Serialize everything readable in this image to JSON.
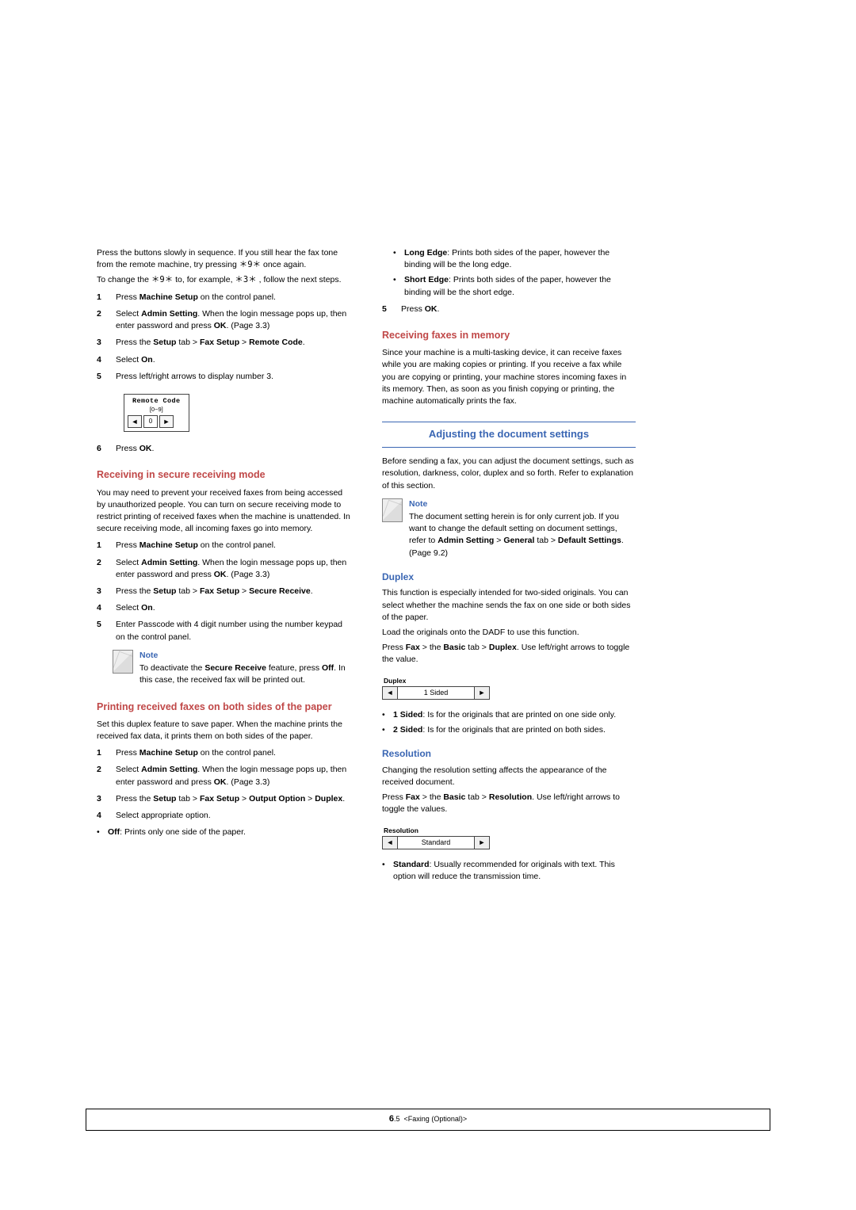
{
  "left": {
    "intro1": "Press the buttons slowly in sequence. If you still hear the fax tone from the remote machine, try pressing ",
    "star9star": "＊9＊",
    "onceagain": " once again.",
    "change_intro": "To change the ",
    "to_eg": " to, for example, ",
    "star3star": "＊3＊",
    "follow": " , follow the next steps.",
    "s1": {
      "num": "1",
      "pre": "Press ",
      "b": "Machine Setup",
      "post": " on the control panel."
    },
    "s2": {
      "num": "2",
      "pre": "Select ",
      "b": "Admin Setting",
      "post": ". When the login message pops up, then enter password and press ",
      "b2": "OK",
      "post2": ". (Page 3.3)"
    },
    "s3": {
      "num": "3",
      "pre": "Press the ",
      "setup": "Setup",
      "gt1": " tab > ",
      "fax": "Fax Setup",
      "gt2": " > ",
      "rc": "Remote Code",
      "end": "."
    },
    "s4": {
      "num": "4",
      "pre": "Select ",
      "b": "On",
      "post": "."
    },
    "s5": {
      "num": "5",
      "txt": "Press left/right arrows to display number 3."
    },
    "remote_title": "Remote Code",
    "remote_range": "[0~9]",
    "remote_val": "0",
    "s6": {
      "num": "6",
      "pre": "Press ",
      "b": "OK",
      "post": "."
    },
    "h_secure": "Receiving in secure receiving mode",
    "secure_p": "You may need to prevent your received faxes from being accessed by unauthorized people. You can turn on secure receiving mode to restrict printing of received faxes when the machine is unattended. In secure receiving mode, all incoming faxes go into memory.",
    "sc1": {
      "num": "1",
      "pre": "Press ",
      "b": "Machine Setup",
      "post": " on the control panel."
    },
    "sc2": {
      "num": "2",
      "pre": "Select ",
      "b": "Admin Setting",
      "post": ". When the login message pops up, then enter password and press ",
      "b2": "OK",
      "post2": ". (Page 3.3)"
    },
    "sc3": {
      "num": "3",
      "pre": "Press the ",
      "setup": "Setup",
      "gt1": " tab > ",
      "fax": "Fax Setup",
      "gt2": " > ",
      "sr": "Secure Receive",
      "end": "."
    },
    "sc4": {
      "num": "4",
      "pre": "Select ",
      "b": "On",
      "post": "."
    },
    "sc5": {
      "num": "5",
      "txt": "Enter Passcode with 4 digit number using the number keypad on the control panel."
    },
    "note1_title": "Note",
    "note1_pre": "To deactivate the ",
    "note1_b": "Secure Receive",
    "note1_mid": " feature, press ",
    "note1_off": "Off",
    "note1_post": ". In this case, the received fax will be printed out.",
    "h_print": "Printing received faxes on both sides of the paper",
    "print_p": "Set this duplex feature to save paper. When the machine prints the received fax data, it prints them on both sides of the paper.",
    "pr1": {
      "num": "1",
      "pre": "Press ",
      "b": "Machine Setup",
      "post": " on the control panel."
    },
    "pr2": {
      "num": "2",
      "pre": "Select ",
      "b": "Admin Setting",
      "post": ". When the login message pops up, then enter password and press ",
      "b2": "OK",
      "post2": ". (Page 3.3)"
    },
    "pr3": {
      "num": "3",
      "pre": "Press the ",
      "setup": "Setup",
      "gt1": " tab > ",
      "fax": "Fax Setup",
      "gt2": " > ",
      "oo": "Output Option",
      "gt3": " > ",
      "dp": "Duplex",
      "end": "."
    },
    "pr4": {
      "num": "4",
      "txt": "Select appropriate option."
    },
    "off_b": "Off",
    "off_txt": ": Prints only one side of the paper."
  },
  "right": {
    "le_b": "Long Edge",
    "le_txt": ": Prints both sides of the paper, however the binding will be the long edge.",
    "se_b": "Short Edge",
    "se_txt": ": Prints both sides of the paper, however the binding will be the short edge.",
    "r5": {
      "num": "5",
      "pre": "Press ",
      "b": "OK",
      "post": "."
    },
    "h_mem": "Receiving faxes in memory",
    "mem_p": "Since your machine is a multi-tasking device, it can receive faxes while you are making copies or printing. If you receive a fax while you are copying or printing, your machine stores incoming faxes in its memory. Then, as soon as you finish copying or printing, the machine automatically prints the fax.",
    "banner": "Adjusting the document settings",
    "adj_p": "Before sending a fax, you can adjust the document settings, such as resolution, darkness, color, duplex and so forth. Refer to explanation of this section.",
    "note2_title": "Note",
    "note2_txt_pre": "The document setting herein is for only current job. If you want to change the default setting on document settings, refer to ",
    "note2_as": "Admin Setting",
    "note2_gt1": " > ",
    "note2_gen": "General",
    "note2_gt2": " tab > ",
    "note2_ds": "Default Settings",
    "note2_post": ". (Page 9.2)",
    "h_duplex": "Duplex",
    "dup_p1": "This function is especially intended for two-sided originals. You can select whether the machine sends the fax on one side or both sides of the paper.",
    "dup_p2": "Load the originals onto the DADF to use this function.",
    "dup_p3_pre": "Press ",
    "dup_fax": "Fax",
    "dup_mid": " > the ",
    "dup_basic": "Basic",
    "dup_mid2": " tab > ",
    "dup_dup": "Duplex",
    "dup_post": ". Use left/right arrows to toggle the value.",
    "dup_spin_title": "Duplex",
    "dup_spin_val": "1 Sided",
    "b1s": "1 Sided",
    "b1s_txt": ": Is for the originals that are printed on one side only.",
    "b2s": "2 Sided",
    "b2s_txt": ": Is for the originals that are printed on both sides.",
    "h_res": "Resolution",
    "res_p1": "Changing the resolution setting affects the appearance of the received document.",
    "res_p2_pre": "Press ",
    "res_fax": "Fax",
    "res_mid": " > the ",
    "res_basic": "Basic",
    "res_mid2": " tab > ",
    "res_res": "Resolution",
    "res_post": ". Use left/right arrows to toggle the values.",
    "res_spin_title": "Resolution",
    "res_spin_val": "Standard",
    "std_b": "Standard",
    "std_txt": ": Usually recommended for originals with text. This option will reduce the transmission time."
  },
  "footer": {
    "pg": "6",
    "sub": ".5",
    "label": "<Faxing (Optional)>"
  }
}
